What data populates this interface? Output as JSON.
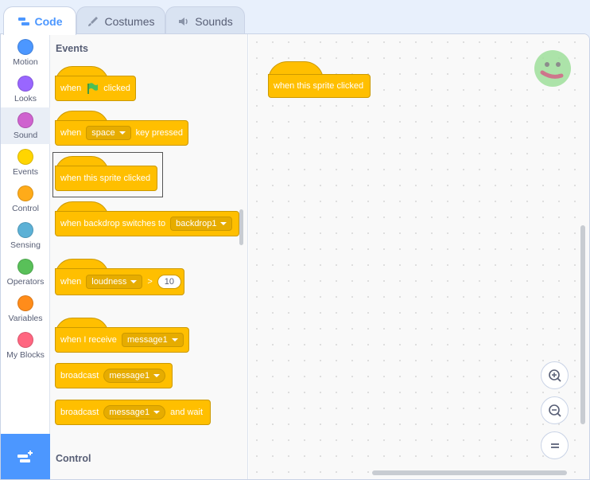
{
  "tabs": [
    {
      "label": "Code",
      "icon": "code-icon"
    },
    {
      "label": "Costumes",
      "icon": "brush-icon"
    },
    {
      "label": "Sounds",
      "icon": "speaker-icon"
    }
  ],
  "categories": [
    {
      "label": "Motion",
      "color": "#4c97ff"
    },
    {
      "label": "Looks",
      "color": "#9966ff"
    },
    {
      "label": "Sound",
      "color": "#cf63cf"
    },
    {
      "label": "Events",
      "color": "#ffd500"
    },
    {
      "label": "Control",
      "color": "#ffab19"
    },
    {
      "label": "Sensing",
      "color": "#5cb1d6"
    },
    {
      "label": "Operators",
      "color": "#59c059"
    },
    {
      "label": "Variables",
      "color": "#ff8c1a"
    },
    {
      "label": "My Blocks",
      "color": "#ff6680"
    }
  ],
  "palette": {
    "section_events": "Events",
    "section_control": "Control",
    "flag_block": {
      "when": "when",
      "clicked": "clicked"
    },
    "key_block": {
      "when": "when",
      "key": "space",
      "rest": "key pressed"
    },
    "sprite_block": {
      "label": "when this sprite clicked"
    },
    "backdrop_block": {
      "label": "when backdrop switches to",
      "value": "backdrop1"
    },
    "loudness_block": {
      "when": "when",
      "sensor": "loudness",
      "op": ">",
      "value": "10"
    },
    "receive_block": {
      "label": "when I receive",
      "message": "message1"
    },
    "broadcast_block": {
      "label": "broadcast",
      "message": "message1"
    },
    "broadcast_wait_block": {
      "label": "broadcast",
      "message": "message1",
      "suffix": "and wait"
    }
  },
  "workspace": {
    "block_label": "when this sprite clicked"
  },
  "colors": {
    "events": "#ffbf00",
    "accent": "#4c97ff"
  }
}
